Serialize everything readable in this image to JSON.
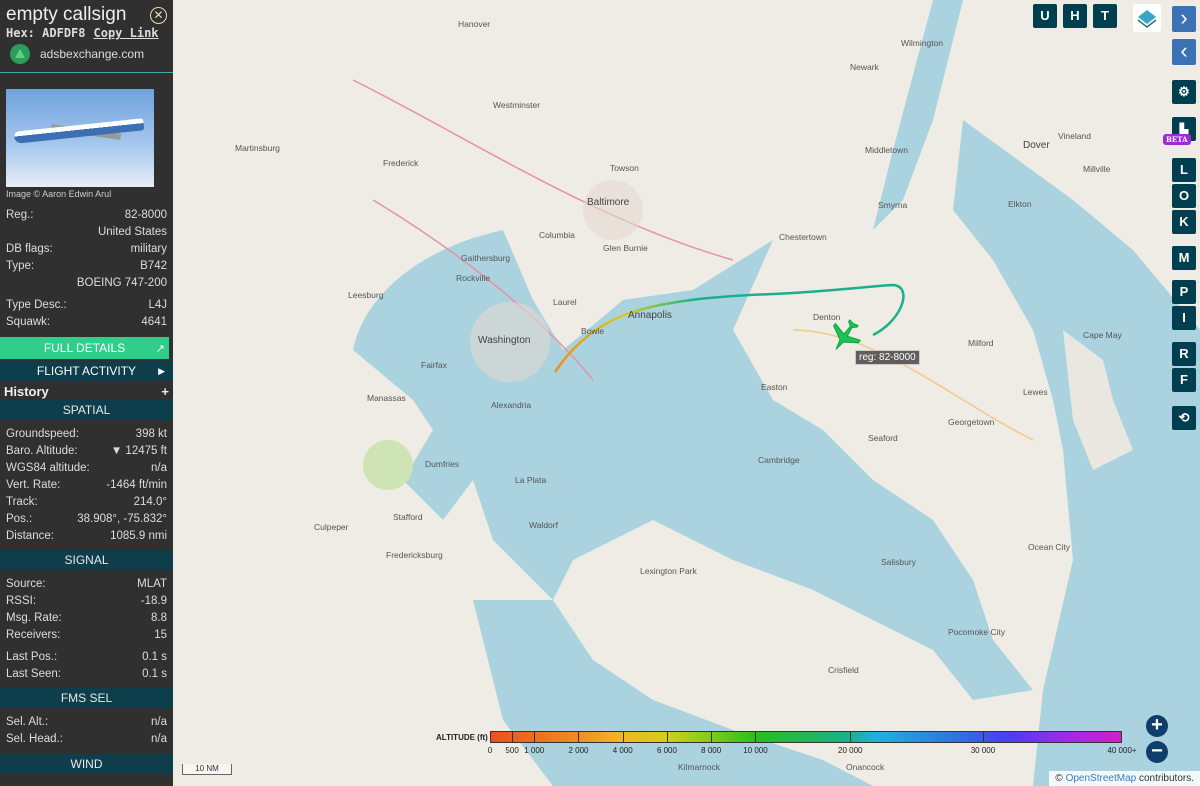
{
  "sidebar": {
    "title": "empty callsign",
    "hex_label": "Hex:",
    "hex": "ADFDF8",
    "copy_link": "Copy Link",
    "site": "adsbexchange.com",
    "image_credit": "Image © Aaron Edwin Arul",
    "info": [
      {
        "label": "Reg.:",
        "value": "82-8000"
      },
      {
        "label": "",
        "value": "United States"
      },
      {
        "label": "DB flags:",
        "value": "military"
      },
      {
        "label": "Type:",
        "value": "B742"
      },
      {
        "label": "",
        "value": "BOEING 747-200"
      },
      {
        "label": "Type Desc.:",
        "value": "L4J"
      },
      {
        "label": "Squawk:",
        "value": "4641"
      }
    ],
    "full_details": "FULL DETAILS",
    "flight_activity": "FLIGHT ACTIVITY",
    "history": "History",
    "spatial_title": "SPATIAL",
    "spatial": [
      {
        "label": "Groundspeed:",
        "value": "398 kt"
      },
      {
        "label": "Baro. Altitude:",
        "value": "▼ 12475 ft"
      },
      {
        "label": "WGS84 altitude:",
        "value": "n/a"
      },
      {
        "label": "Vert. Rate:",
        "value": "-1464 ft/min"
      },
      {
        "label": "Track:",
        "value": "214.0°"
      },
      {
        "label": "Pos.:",
        "value": "38.908°, -75.832°"
      },
      {
        "label": "Distance:",
        "value": "1085.9 nmi"
      }
    ],
    "signal_title": "SIGNAL",
    "signal": [
      {
        "label": "Source:",
        "value": "MLAT"
      },
      {
        "label": "RSSI:",
        "value": "-18.9"
      },
      {
        "label": "Msg. Rate:",
        "value": "8.8"
      },
      {
        "label": "Receivers:",
        "value": "15"
      },
      {
        "label": "Last Pos.:",
        "value": "0.1 s"
      },
      {
        "label": "Last Seen:",
        "value": "0.1 s"
      }
    ],
    "fms_title": "FMS SEL",
    "fms": [
      {
        "label": "Sel. Alt.:",
        "value": "n/a"
      },
      {
        "label": "Sel. Head.:",
        "value": "n/a"
      }
    ],
    "wind_title": "WIND"
  },
  "map": {
    "aircraft_label": "reg: 82-8000",
    "top_buttons": [
      "U",
      "H",
      "T"
    ],
    "side_buttons": [
      "L",
      "O",
      "K",
      "M",
      "P",
      "I",
      "R",
      "F"
    ],
    "beta": "BETA",
    "scale": "10 NM",
    "attribution_prefix": "© ",
    "attribution_link": "OpenStreetMap",
    "attribution_suffix": " contributors.",
    "places": [
      "Washington",
      "Baltimore",
      "Annapolis",
      "Frederick",
      "Leesburg",
      "Manassas",
      "Alexandria",
      "Fairfax",
      "Waldorf",
      "Easton",
      "Dover",
      "Cambridge",
      "Salisbury",
      "Ocean City",
      "Vineland",
      "Newark",
      "Wilmington",
      "Columbia",
      "Bowie",
      "Laurel",
      "Rockville",
      "Gaithersburg",
      "Fredericksburg",
      "Seaford",
      "Milford",
      "Chestertown",
      "Lexington Park",
      "Dumfries",
      "Culpeper",
      "Martinsburg",
      "Westminster",
      "Hanover",
      "Cape May",
      "Lewes",
      "Georgetown",
      "Glen Burnie",
      "Towson",
      "Elkton",
      "Millville",
      "Crisfield",
      "Kilmarnock",
      "Onancock",
      "Pocomoke City",
      "Stafford",
      "La Plata",
      "Middletown",
      "Smyrna",
      "Denton"
    ]
  },
  "legend": {
    "title": "ALTITUDE (ft)",
    "ticks": [
      "0",
      "500",
      "1 000",
      "2 000",
      "4 000",
      "6 000",
      "8 000",
      "10 000",
      "20 000",
      "30 000",
      "40 000+"
    ]
  },
  "colors": {
    "sidebar_bg": "#303030",
    "section_bg": "#0e3e4c",
    "full_details": "#2fce8b",
    "button": "#003f4f",
    "nav": "#3c72b5",
    "aircraft": "#1fbf5a",
    "beta": "#9b2cd6"
  }
}
